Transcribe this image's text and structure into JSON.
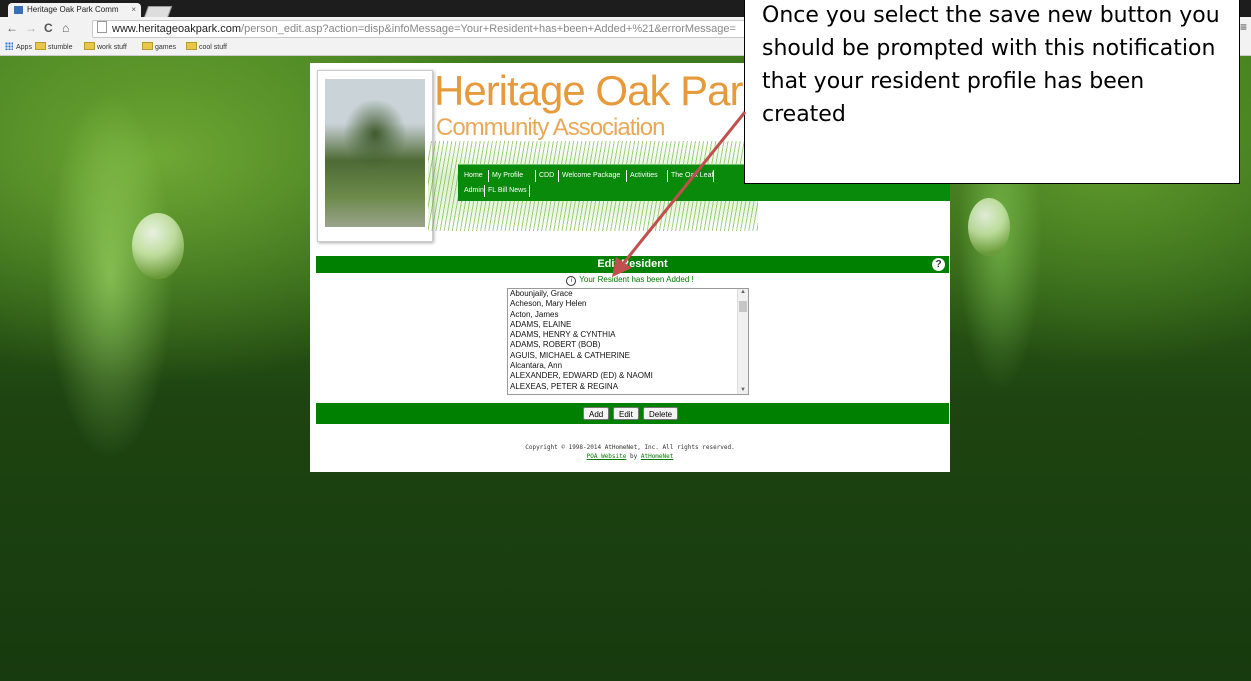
{
  "browser": {
    "tab_title": "Heritage Oak Park Comm",
    "tab_close": "×",
    "url_host": "www.heritageoakpark.com",
    "url_rest": "/person_edit.asp?action=disp&infoMessage=Your+Resident+has+been+Added+%21&errorMessage=",
    "bookmarks": [
      "Apps",
      "stumble",
      "work stuff",
      "games",
      "cool stuff"
    ]
  },
  "site": {
    "title": "Heritage Oak Park",
    "subtitle": "Community Association",
    "nav": [
      "Home",
      "My Profile",
      "CDD",
      "Welcome Package",
      "Activities",
      "The Oak Leaf",
      "Admin",
      "FL Bill News"
    ]
  },
  "panel": {
    "title": "Edit Resident",
    "help": "?",
    "info_message": "Your Resident has been Added !",
    "residents": [
      "Abounjaily, Grace",
      "Acheson, Mary Helen",
      "Acton, James",
      "ADAMS, ELAINE",
      "ADAMS, HENRY & CYNTHIA",
      "ADAMS, ROBERT (BOB)",
      "AGUIS, MICHAEL & CATHERINE",
      "Alcantara, Ann",
      "ALEXANDER, EDWARD (ED) & NAOMI",
      "ALEXEAS, PETER & REGINA"
    ],
    "buttons": {
      "add": "Add",
      "edit": "Edit",
      "delete": "Delete"
    }
  },
  "footer": {
    "copyright": "Copyright © 1998-2014 AtHomeNet, Inc. All rights reserved.",
    "poa_link": "POA Website",
    "by": "by",
    "athomenet_link": "AtHomeNet"
  },
  "callout": {
    "text": "Once you select the save new button you should be prompted with this notification that your resident profile has been created"
  },
  "colors": {
    "brand_green": "#008000",
    "title_orange": "#e69a3c",
    "arrow": "#c0504d"
  }
}
